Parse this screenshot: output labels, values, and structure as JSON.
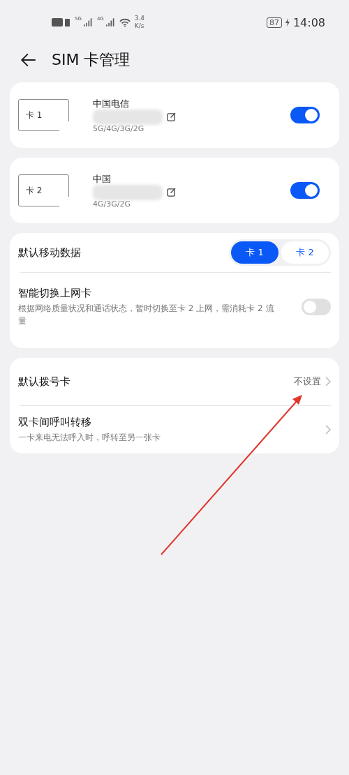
{
  "status_bar": {
    "net_labels": [
      "5G",
      "4G"
    ],
    "speed_value": "3.4",
    "speed_unit": "K/s",
    "battery": "87",
    "time": "14:08"
  },
  "header": {
    "title": "SIM 卡管理"
  },
  "sim_cards": [
    {
      "slot": "卡 1",
      "carrier": "中国电信",
      "networks": "5G/4G/3G/2G",
      "on": true
    },
    {
      "slot": "卡 2",
      "carrier": "中国",
      "networks": "4G/3G/2G",
      "on": true
    }
  ],
  "data_card": {
    "label": "默认移动数据",
    "options": [
      {
        "label": "卡 1",
        "selected": true
      },
      {
        "label": "卡 2",
        "selected": false
      }
    ],
    "smart_switch": {
      "title": "智能切换上网卡",
      "description": "根据网络质量状况和通话状态，暂时切换至卡 2 上网，需消耗卡 2 流量",
      "on": false
    }
  },
  "call_card": [
    {
      "title": "默认拨号卡",
      "value": "不设置"
    },
    {
      "title": "双卡间呼叫转移",
      "description": "一卡来电无法呼入时，呼转至另一张卡"
    }
  ]
}
